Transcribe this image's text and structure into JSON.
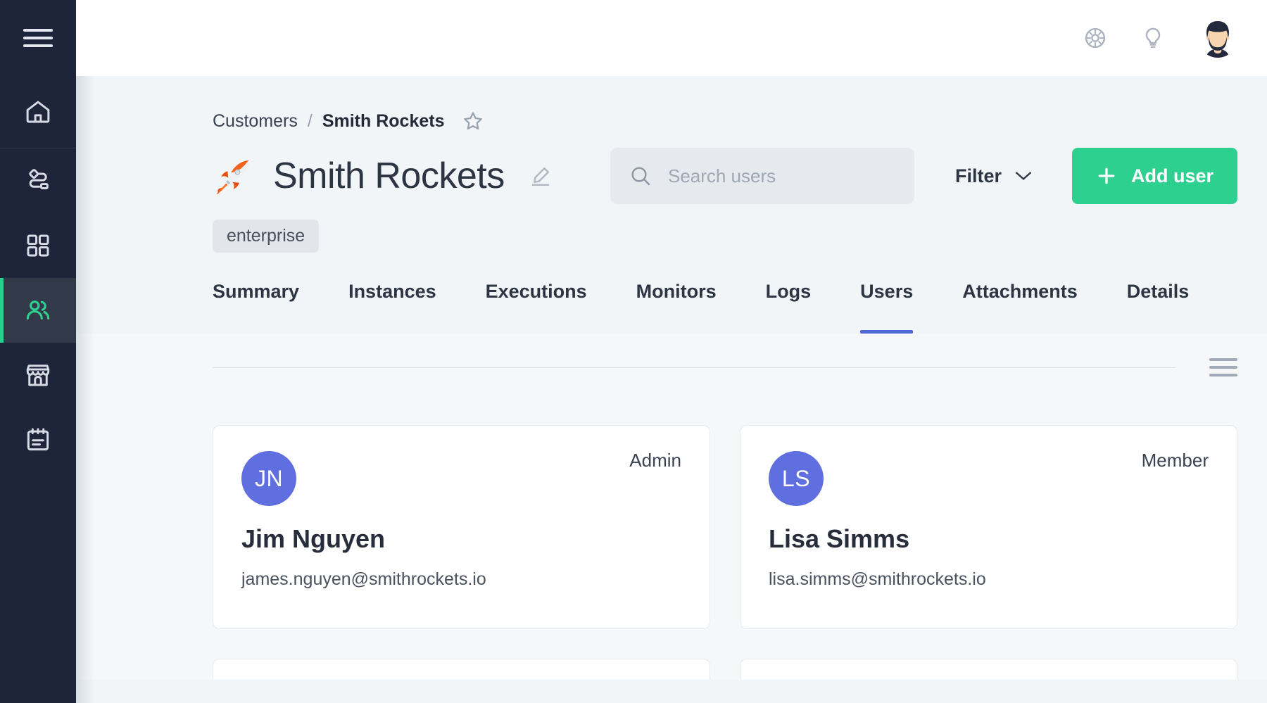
{
  "sidebar": {
    "items": [
      {
        "name": "menu-toggle",
        "icon": "hamburger-icon",
        "active": false
      },
      {
        "name": "home",
        "icon": "home-icon",
        "active": false
      },
      {
        "name": "workflows",
        "icon": "workflow-icon",
        "active": false
      },
      {
        "name": "apps",
        "icon": "grid-icon",
        "active": false
      },
      {
        "name": "customers",
        "icon": "users-icon",
        "active": true
      },
      {
        "name": "marketplace",
        "icon": "store-icon",
        "active": false
      },
      {
        "name": "notes",
        "icon": "clipboard-icon",
        "active": false
      }
    ],
    "background_color": "#1e2439",
    "active_background_color": "#323949",
    "active_accent_color": "#26d08d"
  },
  "topbar": {
    "icons": [
      {
        "name": "help-wheel-icon",
        "label": "Help"
      },
      {
        "name": "lightbulb-icon",
        "label": "Ideas"
      }
    ],
    "avatar": {
      "name": "user-avatar",
      "label": "Account"
    }
  },
  "breadcrumb": {
    "parent": "Customers",
    "separator": "/",
    "current": "Smith Rockets",
    "favorite_icon": "star-icon"
  },
  "page": {
    "emoji": "🚀",
    "title": "Smith Rockets",
    "edit_icon": "pencil-icon",
    "badge": "enterprise"
  },
  "search": {
    "placeholder": "Search users",
    "value": "",
    "icon": "search-icon"
  },
  "filter": {
    "label": "Filter",
    "icon": "chevron-down-icon"
  },
  "add_user": {
    "label": "Add user",
    "icon": "plus-icon",
    "color": "#2ed08f"
  },
  "tabs": {
    "items": [
      {
        "label": "Summary",
        "active": false
      },
      {
        "label": "Instances",
        "active": false
      },
      {
        "label": "Executions",
        "active": false
      },
      {
        "label": "Monitors",
        "active": false
      },
      {
        "label": "Logs",
        "active": false
      },
      {
        "label": "Users",
        "active": true
      },
      {
        "label": "Attachments",
        "active": false
      },
      {
        "label": "Details",
        "active": false
      }
    ],
    "active_underline_color": "#5069d6"
  },
  "list_toolbar": {
    "view_toggle_icon": "list-view-icon"
  },
  "users": [
    {
      "initials": "JN",
      "name": "Jim Nguyen",
      "email": "james.nguyen@smithrockets.io",
      "role": "Admin",
      "avatar_color": "#5f6fe0"
    },
    {
      "initials": "LS",
      "name": "Lisa Simms",
      "email": "lisa.simms@smithrockets.io",
      "role": "Member",
      "avatar_color": "#5f6fe0"
    }
  ]
}
